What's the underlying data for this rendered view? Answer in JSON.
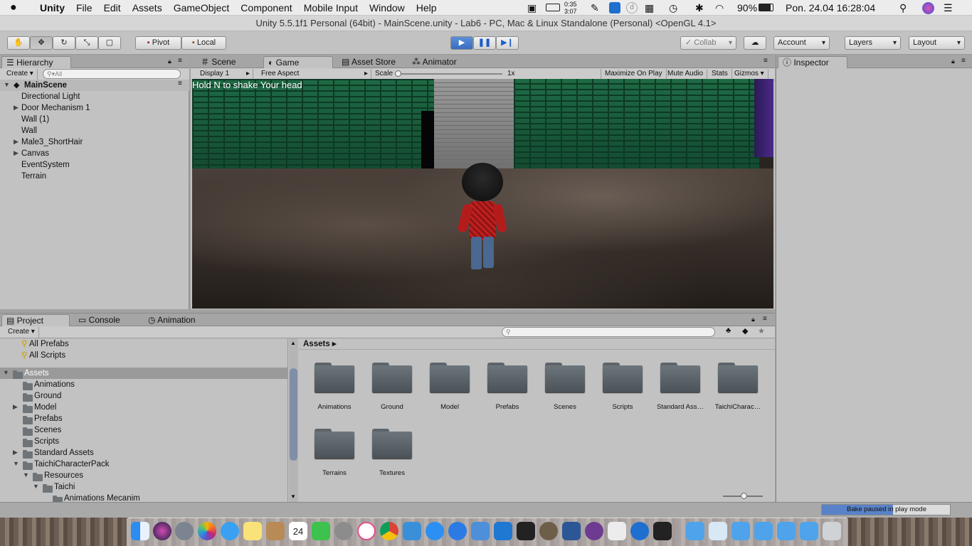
{
  "menubar": {
    "app": "Unity",
    "items": [
      "File",
      "Edit",
      "Assets",
      "GameObject",
      "Component",
      "Mobile Input",
      "Window",
      "Help"
    ],
    "clock_small_top": "0:35",
    "clock_small_bottom": "3:07",
    "battery": "90%",
    "datetime": "Pon. 24.04  16:28:04"
  },
  "window": {
    "title": "Unity 5.5.1f1 Personal (64bit) - MainScene.unity - Lab6 - PC, Mac & Linux Standalone (Personal) <OpenGL 4.1>"
  },
  "toolbar": {
    "pivot": "Pivot",
    "local": "Local",
    "collab": "Collab",
    "account": "Account",
    "layers": "Layers",
    "layout": "Layout"
  },
  "hierarchy": {
    "tab": "Hierarchy",
    "create": "Create",
    "search_placeholder": "All",
    "scene": "MainScene",
    "items": [
      {
        "label": "Directional Light",
        "expandable": false
      },
      {
        "label": "Door Mechanism 1",
        "expandable": true
      },
      {
        "label": "Wall (1)",
        "expandable": false
      },
      {
        "label": "Wall",
        "expandable": false
      },
      {
        "label": "Male3_ShortHair",
        "expandable": true
      },
      {
        "label": "Canvas",
        "expandable": true
      },
      {
        "label": "EventSystem",
        "expandable": false
      },
      {
        "label": "Terrain",
        "expandable": false
      }
    ]
  },
  "center_tabs": [
    "Scene",
    "Game",
    "Asset Store",
    "Animator"
  ],
  "game_bar": {
    "display": "Display 1",
    "aspect": "Free Aspect",
    "scale_label": "Scale",
    "scale_value": "1x",
    "buttons": [
      "Maximize On Play",
      "Mute Audio",
      "Stats",
      "Gizmos"
    ]
  },
  "game": {
    "overlay_text": "Hold N to shake Your head"
  },
  "inspector": {
    "tab": "Inspector"
  },
  "bottom_tabs": [
    "Project",
    "Console",
    "Animation"
  ],
  "project": {
    "create": "Create",
    "favorites": [
      "All Prefabs",
      "All Scripts"
    ],
    "tree": [
      {
        "label": "Assets",
        "depth": 0,
        "expanded": true
      },
      {
        "label": "Animations",
        "depth": 1
      },
      {
        "label": "Ground",
        "depth": 1
      },
      {
        "label": "Model",
        "depth": 1,
        "expandable": true
      },
      {
        "label": "Prefabs",
        "depth": 1
      },
      {
        "label": "Scenes",
        "depth": 1
      },
      {
        "label": "Scripts",
        "depth": 1
      },
      {
        "label": "Standard Assets",
        "depth": 1,
        "expandable": true
      },
      {
        "label": "TaichiCharacterPack",
        "depth": 1,
        "expanded": true
      },
      {
        "label": "Resources",
        "depth": 2,
        "expanded": true
      },
      {
        "label": "Taichi",
        "depth": 3,
        "expanded": true
      },
      {
        "label": "Animations Mecanim",
        "depth": 4
      }
    ],
    "breadcrumb": "Assets",
    "folders": [
      "Animations",
      "Ground",
      "Model",
      "Prefabs",
      "Scenes",
      "Scripts",
      "Standard Ass…",
      "TaichiCharac…",
      "Terrains",
      "Textures"
    ]
  },
  "status": {
    "bake": "Bake paused in play mode"
  }
}
